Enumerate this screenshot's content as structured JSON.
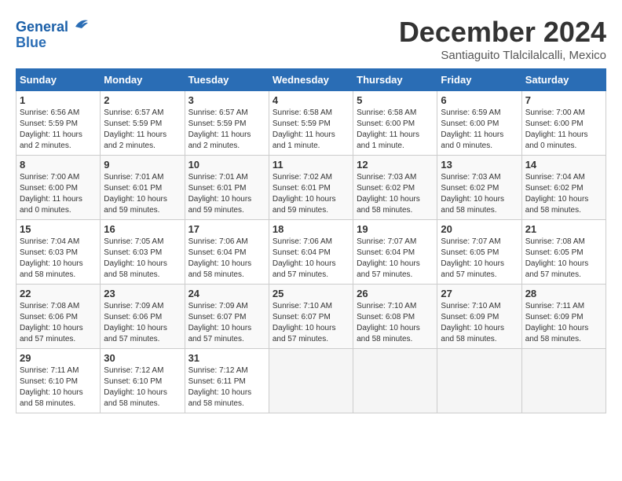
{
  "header": {
    "logo_line1": "General",
    "logo_line2": "Blue",
    "month": "December 2024",
    "location": "Santiaguito Tlalcilalcalli, Mexico"
  },
  "weekdays": [
    "Sunday",
    "Monday",
    "Tuesday",
    "Wednesday",
    "Thursday",
    "Friday",
    "Saturday"
  ],
  "weeks": [
    [
      {
        "day": "1",
        "info": "Sunrise: 6:56 AM\nSunset: 5:59 PM\nDaylight: 11 hours and 2 minutes."
      },
      {
        "day": "2",
        "info": "Sunrise: 6:57 AM\nSunset: 5:59 PM\nDaylight: 11 hours and 2 minutes."
      },
      {
        "day": "3",
        "info": "Sunrise: 6:57 AM\nSunset: 5:59 PM\nDaylight: 11 hours and 2 minutes."
      },
      {
        "day": "4",
        "info": "Sunrise: 6:58 AM\nSunset: 5:59 PM\nDaylight: 11 hours and 1 minute."
      },
      {
        "day": "5",
        "info": "Sunrise: 6:58 AM\nSunset: 6:00 PM\nDaylight: 11 hours and 1 minute."
      },
      {
        "day": "6",
        "info": "Sunrise: 6:59 AM\nSunset: 6:00 PM\nDaylight: 11 hours and 0 minutes."
      },
      {
        "day": "7",
        "info": "Sunrise: 7:00 AM\nSunset: 6:00 PM\nDaylight: 11 hours and 0 minutes."
      }
    ],
    [
      {
        "day": "8",
        "info": "Sunrise: 7:00 AM\nSunset: 6:00 PM\nDaylight: 11 hours and 0 minutes."
      },
      {
        "day": "9",
        "info": "Sunrise: 7:01 AM\nSunset: 6:01 PM\nDaylight: 10 hours and 59 minutes."
      },
      {
        "day": "10",
        "info": "Sunrise: 7:01 AM\nSunset: 6:01 PM\nDaylight: 10 hours and 59 minutes."
      },
      {
        "day": "11",
        "info": "Sunrise: 7:02 AM\nSunset: 6:01 PM\nDaylight: 10 hours and 59 minutes."
      },
      {
        "day": "12",
        "info": "Sunrise: 7:03 AM\nSunset: 6:02 PM\nDaylight: 10 hours and 58 minutes."
      },
      {
        "day": "13",
        "info": "Sunrise: 7:03 AM\nSunset: 6:02 PM\nDaylight: 10 hours and 58 minutes."
      },
      {
        "day": "14",
        "info": "Sunrise: 7:04 AM\nSunset: 6:02 PM\nDaylight: 10 hours and 58 minutes."
      }
    ],
    [
      {
        "day": "15",
        "info": "Sunrise: 7:04 AM\nSunset: 6:03 PM\nDaylight: 10 hours and 58 minutes."
      },
      {
        "day": "16",
        "info": "Sunrise: 7:05 AM\nSunset: 6:03 PM\nDaylight: 10 hours and 58 minutes."
      },
      {
        "day": "17",
        "info": "Sunrise: 7:06 AM\nSunset: 6:04 PM\nDaylight: 10 hours and 58 minutes."
      },
      {
        "day": "18",
        "info": "Sunrise: 7:06 AM\nSunset: 6:04 PM\nDaylight: 10 hours and 57 minutes."
      },
      {
        "day": "19",
        "info": "Sunrise: 7:07 AM\nSunset: 6:04 PM\nDaylight: 10 hours and 57 minutes."
      },
      {
        "day": "20",
        "info": "Sunrise: 7:07 AM\nSunset: 6:05 PM\nDaylight: 10 hours and 57 minutes."
      },
      {
        "day": "21",
        "info": "Sunrise: 7:08 AM\nSunset: 6:05 PM\nDaylight: 10 hours and 57 minutes."
      }
    ],
    [
      {
        "day": "22",
        "info": "Sunrise: 7:08 AM\nSunset: 6:06 PM\nDaylight: 10 hours and 57 minutes."
      },
      {
        "day": "23",
        "info": "Sunrise: 7:09 AM\nSunset: 6:06 PM\nDaylight: 10 hours and 57 minutes."
      },
      {
        "day": "24",
        "info": "Sunrise: 7:09 AM\nSunset: 6:07 PM\nDaylight: 10 hours and 57 minutes."
      },
      {
        "day": "25",
        "info": "Sunrise: 7:10 AM\nSunset: 6:07 PM\nDaylight: 10 hours and 57 minutes."
      },
      {
        "day": "26",
        "info": "Sunrise: 7:10 AM\nSunset: 6:08 PM\nDaylight: 10 hours and 58 minutes."
      },
      {
        "day": "27",
        "info": "Sunrise: 7:10 AM\nSunset: 6:09 PM\nDaylight: 10 hours and 58 minutes."
      },
      {
        "day": "28",
        "info": "Sunrise: 7:11 AM\nSunset: 6:09 PM\nDaylight: 10 hours and 58 minutes."
      }
    ],
    [
      {
        "day": "29",
        "info": "Sunrise: 7:11 AM\nSunset: 6:10 PM\nDaylight: 10 hours and 58 minutes."
      },
      {
        "day": "30",
        "info": "Sunrise: 7:12 AM\nSunset: 6:10 PM\nDaylight: 10 hours and 58 minutes."
      },
      {
        "day": "31",
        "info": "Sunrise: 7:12 AM\nSunset: 6:11 PM\nDaylight: 10 hours and 58 minutes."
      },
      null,
      null,
      null,
      null
    ]
  ]
}
